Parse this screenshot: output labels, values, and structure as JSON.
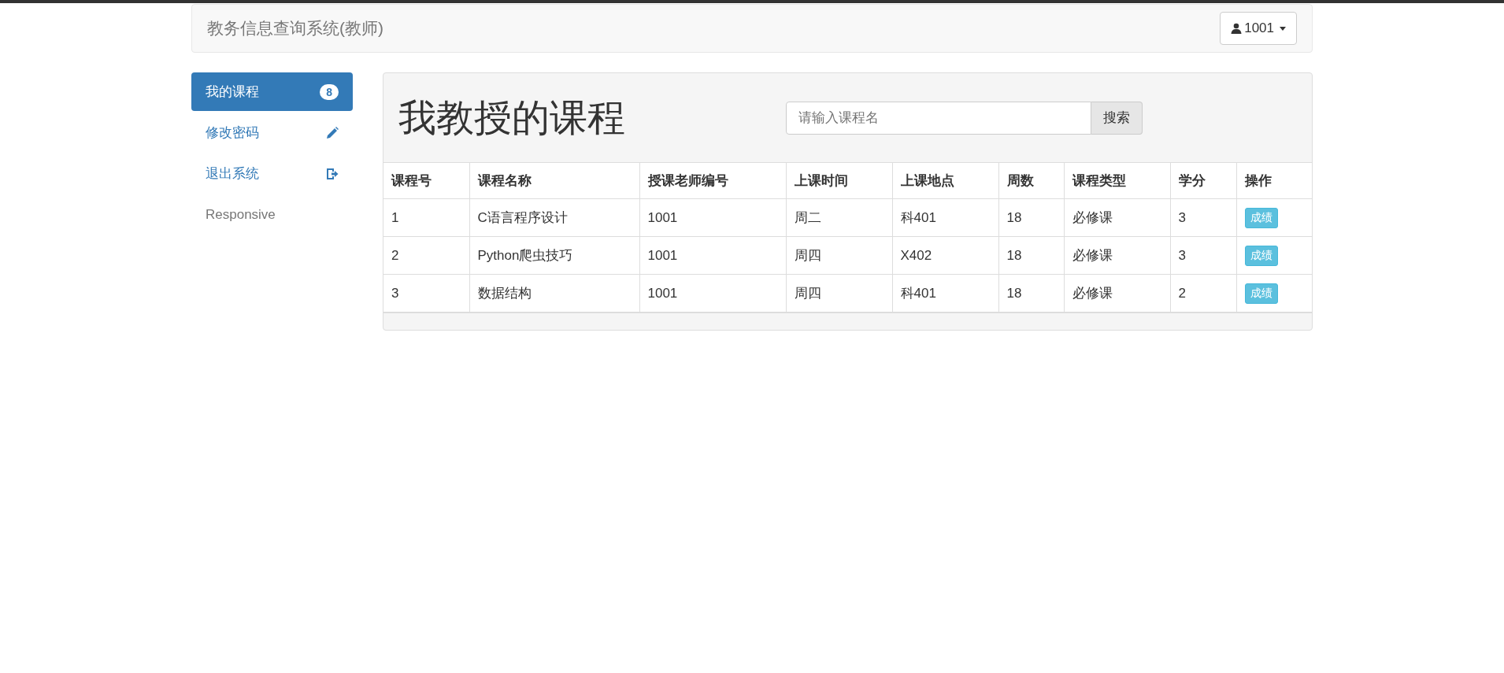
{
  "navbar": {
    "brand": "教务信息查询系统(教师)",
    "user": "1001"
  },
  "sidebar": {
    "items": [
      {
        "label": "我的课程",
        "kind": "badge",
        "badge": "8",
        "selected": true
      },
      {
        "label": "修改密码",
        "kind": "pencil",
        "selected": false
      },
      {
        "label": "退出系统",
        "kind": "logout",
        "selected": false
      },
      {
        "label": "Responsive",
        "kind": "muted",
        "selected": false
      }
    ]
  },
  "panel": {
    "title": "我教授的课程",
    "search": {
      "placeholder": "请输入课程名",
      "button": "搜索"
    }
  },
  "table": {
    "columns": [
      "课程号",
      "课程名称",
      "授课老师编号",
      "上课时间",
      "上课地点",
      "周数",
      "课程类型",
      "学分",
      "操作"
    ],
    "rows": [
      {
        "cells": [
          "1",
          "C语言程序设计",
          "1001",
          "周二",
          "科401",
          "18",
          "必修课",
          "3"
        ],
        "action": "成绩"
      },
      {
        "cells": [
          "2",
          "Python爬虫技巧",
          "1001",
          "周四",
          "X402",
          "18",
          "必修课",
          "3"
        ],
        "action": "成绩"
      },
      {
        "cells": [
          "3",
          "数据结构",
          "1001",
          "周四",
          "科401",
          "18",
          "必修课",
          "2"
        ],
        "action": "成绩"
      }
    ]
  }
}
